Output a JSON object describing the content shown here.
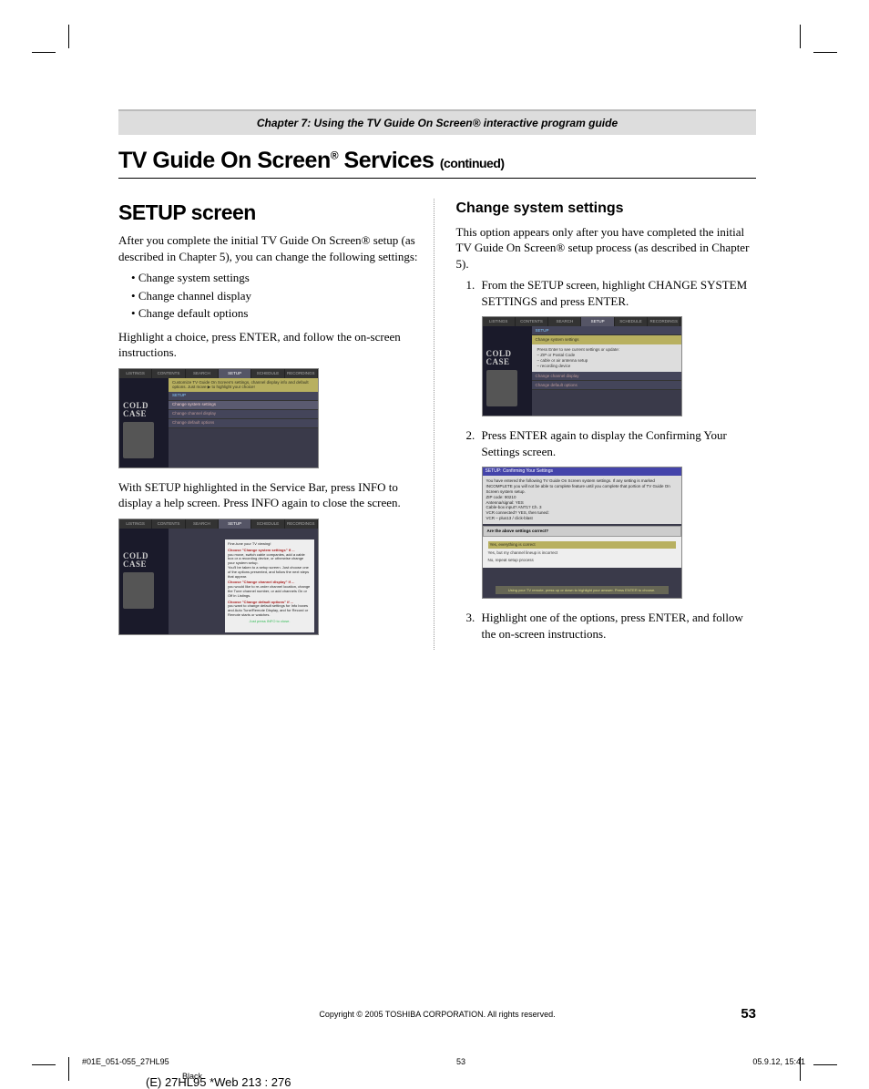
{
  "chapter_bar": "Chapter 7: Using the TV Guide On Screen® interactive program guide",
  "title_main": "TV Guide On Screen",
  "title_reg": "®",
  "title_services": " Services ",
  "title_cont": "(continued)",
  "left": {
    "heading": "SETUP screen",
    "p1": "After you complete the initial TV Guide On Screen® setup (as described in Chapter 5), you can change the following settings:",
    "bullets": [
      "Change system settings",
      "Change channel display",
      "Change default options"
    ],
    "p2": "Highlight a choice, press ENTER, and follow the on-screen instructions.",
    "p3": "With SETUP highlighted in the Service Bar, press INFO to display a help screen. Press INFO again to close the screen."
  },
  "right": {
    "heading": "Change system settings",
    "p1": "This option appears only after you have completed the initial TV Guide On Screen® setup process (as described in Chapter 5).",
    "steps": [
      "From the SETUP screen, highlight CHANGE SYSTEM SETTINGS and press ENTER.",
      "Press ENTER again to display the Confirming Your Settings screen.",
      "Highlight one of the options, press ENTER, and follow the on-screen instructions."
    ]
  },
  "ss1": {
    "tabs": [
      "LISTINGS",
      "CONTENTS",
      "SEARCH",
      "SETUP",
      "SCHEDULE",
      "RECORDINGS"
    ],
    "yellow": "Customize TV Guide On Screen's settings, channel display info and default options. Just move ▶ to highlight your choice!",
    "cold": "COLD CASE",
    "setup_label": "SETUP",
    "rows": [
      "Change system settings",
      "Change channel display",
      "Change default options"
    ]
  },
  "ss2": {
    "title": "Fine-tune your TV viewing!",
    "g1": "Choose \"Change system settings\" if ...",
    "g1_items": [
      "you move, switch cable companies, add a cable box or a recording device, or otherwise change your system setup."
    ],
    "g1_note": "You'll be taken to a setup screen. Just choose one of the options presented, and follow the next steps that appear.",
    "g2": "Choose \"Change channel display\" if ...",
    "g2_items": [
      "you would like to re-order channel location, change the Tune channel number, or add channels On or Off in Listings."
    ],
    "g3": "Choose \"Change default options\" if ...",
    "g3_items": [
      "you want to change default settings for Info boxes and Auto Tune/Remote Display, and for Record or Remote starts or watches."
    ],
    "press": "Just press INFO to close."
  },
  "ss3": {
    "tabs": [
      "LISTINGS",
      "CONTENTS",
      "SEARCH",
      "SETUP",
      "SCHEDULE",
      "RECORDINGS"
    ],
    "setup_label": "SETUP",
    "hl_row": "Change system settings",
    "other_rows": [
      "Change channel display",
      "Change default options"
    ],
    "box_text": "Press Enter to see current settings or update:\n– ZIP or Postal Code\n– cable or air antenna setup\n– recording device",
    "cold": "COLD CASE"
  },
  "ss4": {
    "title": "SETUP: Confirming Your Settings",
    "top": "You have entered the following TV Guide On Screen system settings. If any setting is marked INCOMPLETE you will not be able to complete feature until you complete that portion of TV Guide On Screen system setup.\nZIP code: 90210\nAntenna/signal: YES\nCable-box input? ANT1? Ch. 3\nVCR connected? YES, then tuned:\nVCR – plus13 / click-blast",
    "question": "Are the above settings correct?",
    "opts": [
      "Yes, everything is correct",
      "Yes, but my channel lineup is incorrect",
      "No, repeat setup process"
    ],
    "foot": "Using your TV remote, press up or down to highlight your answer. Press ENTER to choose."
  },
  "footer": {
    "copyright": "Copyright © 2005 TOSHIBA CORPORATION. All rights reserved.",
    "page": "53"
  },
  "printer": {
    "file": "#01E_051-055_27HL95",
    "pg": "53",
    "dt": "05.9.12, 15:41",
    "ink": "Black",
    "web": "(E) 27HL95 *Web 213 : 276"
  }
}
